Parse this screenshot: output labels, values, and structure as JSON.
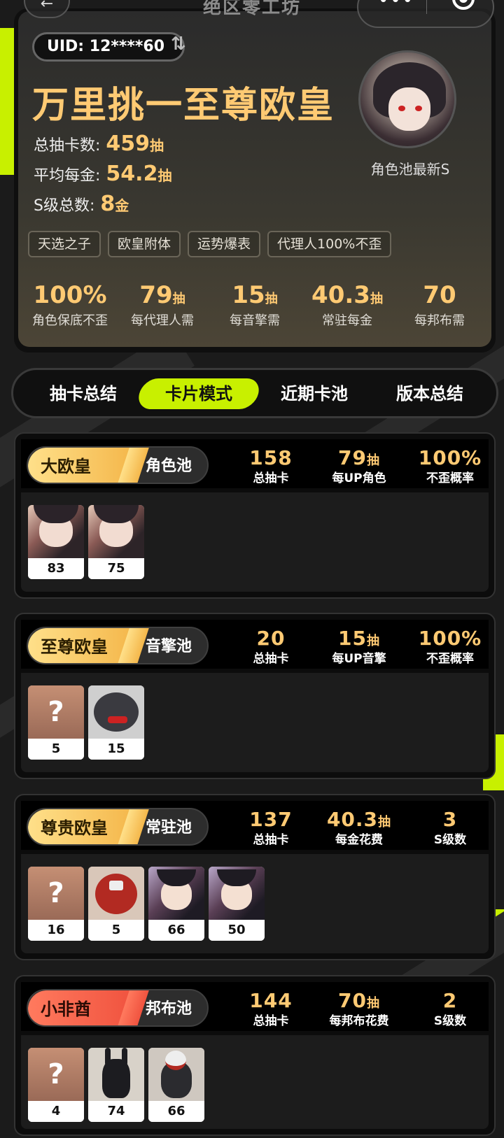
{
  "nav": {
    "title": "绝区零工坊",
    "back_icon": "back-arrow-icon",
    "menu_icon": "more-dots-icon",
    "close_icon": "target-circle-icon"
  },
  "profile": {
    "uid": "UID: 12****60",
    "title": "万里挑一至尊欧皇",
    "stats": [
      {
        "label": "总抽卡数:",
        "value": "459",
        "unit": "抽"
      },
      {
        "label": "平均每金:",
        "value": "54.2",
        "unit": "抽"
      },
      {
        "label": "S级总数:",
        "value": "8",
        "unit": "金"
      }
    ],
    "avatar_caption": "角色池最新S",
    "tags": [
      "天选之子",
      "欧皇附体",
      "运势爆表",
      "代理人100%不歪"
    ],
    "summary": [
      {
        "value": "100%",
        "unit": "",
        "label": "角色保底不歪"
      },
      {
        "value": "79",
        "unit": "抽",
        "label": "每代理人需"
      },
      {
        "value": "15",
        "unit": "抽",
        "label": "每音擎需"
      },
      {
        "value": "40.3",
        "unit": "抽",
        "label": "常驻每金"
      },
      {
        "value": "70",
        "unit": "",
        "label": "每邦布需"
      }
    ]
  },
  "tabs": [
    "抽卡总结",
    "卡片模式",
    "近期卡池",
    "版本总结"
  ],
  "active_tab": "卡片模式",
  "pools": [
    {
      "rank": "大欧皇",
      "name": "角色池",
      "badge_color": "gold",
      "stats": [
        {
          "value": "158",
          "unit": "",
          "label": "总抽卡"
        },
        {
          "value": "79",
          "unit": "抽",
          "label": "每UP角色"
        },
        {
          "value": "100%",
          "unit": "",
          "label": "不歪概率"
        }
      ],
      "chars": [
        {
          "type": "girl",
          "count": "83"
        },
        {
          "type": "girl",
          "count": "75"
        }
      ]
    },
    {
      "rank": "至尊欧皇",
      "name": "音擎池",
      "badge_color": "gold",
      "stats": [
        {
          "value": "20",
          "unit": "",
          "label": "总抽卡"
        },
        {
          "value": "15",
          "unit": "抽",
          "label": "每UP音擎"
        },
        {
          "value": "100%",
          "unit": "",
          "label": "不歪概率"
        }
      ],
      "chars": [
        {
          "type": "unknown",
          "count": "5"
        },
        {
          "type": "shark",
          "count": "15"
        }
      ]
    },
    {
      "rank": "尊贵欧皇",
      "name": "常驻池",
      "badge_color": "gold",
      "stats": [
        {
          "value": "137",
          "unit": "",
          "label": "总抽卡"
        },
        {
          "value": "40.3",
          "unit": "抽",
          "label": "每金花费"
        },
        {
          "value": "3",
          "unit": "",
          "label": "S级数"
        }
      ],
      "chars": [
        {
          "type": "unknown",
          "count": "16"
        },
        {
          "type": "robot",
          "count": "5"
        },
        {
          "type": "girl2",
          "count": "66"
        },
        {
          "type": "girl2",
          "count": "50"
        }
      ]
    },
    {
      "rank": "小非酋",
      "name": "邦布池",
      "badge_color": "red",
      "stats": [
        {
          "value": "144",
          "unit": "",
          "label": "总抽卡"
        },
        {
          "value": "70",
          "unit": "抽",
          "label": "每邦布花费"
        },
        {
          "value": "2",
          "unit": "",
          "label": "S级数"
        }
      ],
      "chars": [
        {
          "type": "unknown",
          "count": "4"
        },
        {
          "type": "bunny",
          "count": "74"
        },
        {
          "type": "bunny2",
          "count": "66"
        }
      ]
    }
  ],
  "colors": {
    "accent_gold": "#ffca73",
    "accent_lime": "#c8f000",
    "badge_red": "#f0533f"
  }
}
